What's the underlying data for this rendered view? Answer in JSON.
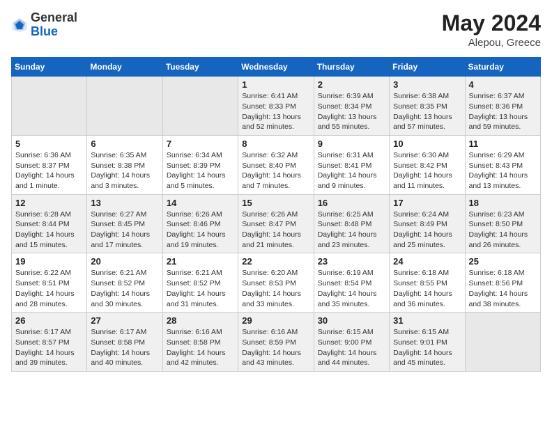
{
  "header": {
    "logo": {
      "line1": "General",
      "line2": "Blue"
    },
    "title": "May 2024",
    "location": "Alepou, Greece"
  },
  "weekdays": [
    "Sunday",
    "Monday",
    "Tuesday",
    "Wednesday",
    "Thursday",
    "Friday",
    "Saturday"
  ],
  "weeks": [
    [
      {
        "day": "",
        "sunrise": "",
        "sunset": "",
        "daylight": "",
        "empty": true
      },
      {
        "day": "",
        "sunrise": "",
        "sunset": "",
        "daylight": "",
        "empty": true
      },
      {
        "day": "",
        "sunrise": "",
        "sunset": "",
        "daylight": "",
        "empty": true
      },
      {
        "day": "1",
        "sunrise": "Sunrise: 6:41 AM",
        "sunset": "Sunset: 8:33 PM",
        "daylight": "Daylight: 13 hours and 52 minutes."
      },
      {
        "day": "2",
        "sunrise": "Sunrise: 6:39 AM",
        "sunset": "Sunset: 8:34 PM",
        "daylight": "Daylight: 13 hours and 55 minutes."
      },
      {
        "day": "3",
        "sunrise": "Sunrise: 6:38 AM",
        "sunset": "Sunset: 8:35 PM",
        "daylight": "Daylight: 13 hours and 57 minutes."
      },
      {
        "day": "4",
        "sunrise": "Sunrise: 6:37 AM",
        "sunset": "Sunset: 8:36 PM",
        "daylight": "Daylight: 13 hours and 59 minutes."
      }
    ],
    [
      {
        "day": "5",
        "sunrise": "Sunrise: 6:36 AM",
        "sunset": "Sunset: 8:37 PM",
        "daylight": "Daylight: 14 hours and 1 minute."
      },
      {
        "day": "6",
        "sunrise": "Sunrise: 6:35 AM",
        "sunset": "Sunset: 8:38 PM",
        "daylight": "Daylight: 14 hours and 3 minutes."
      },
      {
        "day": "7",
        "sunrise": "Sunrise: 6:34 AM",
        "sunset": "Sunset: 8:39 PM",
        "daylight": "Daylight: 14 hours and 5 minutes."
      },
      {
        "day": "8",
        "sunrise": "Sunrise: 6:32 AM",
        "sunset": "Sunset: 8:40 PM",
        "daylight": "Daylight: 14 hours and 7 minutes."
      },
      {
        "day": "9",
        "sunrise": "Sunrise: 6:31 AM",
        "sunset": "Sunset: 8:41 PM",
        "daylight": "Daylight: 14 hours and 9 minutes."
      },
      {
        "day": "10",
        "sunrise": "Sunrise: 6:30 AM",
        "sunset": "Sunset: 8:42 PM",
        "daylight": "Daylight: 14 hours and 11 minutes."
      },
      {
        "day": "11",
        "sunrise": "Sunrise: 6:29 AM",
        "sunset": "Sunset: 8:43 PM",
        "daylight": "Daylight: 14 hours and 13 minutes."
      }
    ],
    [
      {
        "day": "12",
        "sunrise": "Sunrise: 6:28 AM",
        "sunset": "Sunset: 8:44 PM",
        "daylight": "Daylight: 14 hours and 15 minutes."
      },
      {
        "day": "13",
        "sunrise": "Sunrise: 6:27 AM",
        "sunset": "Sunset: 8:45 PM",
        "daylight": "Daylight: 14 hours and 17 minutes."
      },
      {
        "day": "14",
        "sunrise": "Sunrise: 6:26 AM",
        "sunset": "Sunset: 8:46 PM",
        "daylight": "Daylight: 14 hours and 19 minutes."
      },
      {
        "day": "15",
        "sunrise": "Sunrise: 6:26 AM",
        "sunset": "Sunset: 8:47 PM",
        "daylight": "Daylight: 14 hours and 21 minutes."
      },
      {
        "day": "16",
        "sunrise": "Sunrise: 6:25 AM",
        "sunset": "Sunset: 8:48 PM",
        "daylight": "Daylight: 14 hours and 23 minutes."
      },
      {
        "day": "17",
        "sunrise": "Sunrise: 6:24 AM",
        "sunset": "Sunset: 8:49 PM",
        "daylight": "Daylight: 14 hours and 25 minutes."
      },
      {
        "day": "18",
        "sunrise": "Sunrise: 6:23 AM",
        "sunset": "Sunset: 8:50 PM",
        "daylight": "Daylight: 14 hours and 26 minutes."
      }
    ],
    [
      {
        "day": "19",
        "sunrise": "Sunrise: 6:22 AM",
        "sunset": "Sunset: 8:51 PM",
        "daylight": "Daylight: 14 hours and 28 minutes."
      },
      {
        "day": "20",
        "sunrise": "Sunrise: 6:21 AM",
        "sunset": "Sunset: 8:52 PM",
        "daylight": "Daylight: 14 hours and 30 minutes."
      },
      {
        "day": "21",
        "sunrise": "Sunrise: 6:21 AM",
        "sunset": "Sunset: 8:52 PM",
        "daylight": "Daylight: 14 hours and 31 minutes."
      },
      {
        "day": "22",
        "sunrise": "Sunrise: 6:20 AM",
        "sunset": "Sunset: 8:53 PM",
        "daylight": "Daylight: 14 hours and 33 minutes."
      },
      {
        "day": "23",
        "sunrise": "Sunrise: 6:19 AM",
        "sunset": "Sunset: 8:54 PM",
        "daylight": "Daylight: 14 hours and 35 minutes."
      },
      {
        "day": "24",
        "sunrise": "Sunrise: 6:18 AM",
        "sunset": "Sunset: 8:55 PM",
        "daylight": "Daylight: 14 hours and 36 minutes."
      },
      {
        "day": "25",
        "sunrise": "Sunrise: 6:18 AM",
        "sunset": "Sunset: 8:56 PM",
        "daylight": "Daylight: 14 hours and 38 minutes."
      }
    ],
    [
      {
        "day": "26",
        "sunrise": "Sunrise: 6:17 AM",
        "sunset": "Sunset: 8:57 PM",
        "daylight": "Daylight: 14 hours and 39 minutes."
      },
      {
        "day": "27",
        "sunrise": "Sunrise: 6:17 AM",
        "sunset": "Sunset: 8:58 PM",
        "daylight": "Daylight: 14 hours and 40 minutes."
      },
      {
        "day": "28",
        "sunrise": "Sunrise: 6:16 AM",
        "sunset": "Sunset: 8:58 PM",
        "daylight": "Daylight: 14 hours and 42 minutes."
      },
      {
        "day": "29",
        "sunrise": "Sunrise: 6:16 AM",
        "sunset": "Sunset: 8:59 PM",
        "daylight": "Daylight: 14 hours and 43 minutes."
      },
      {
        "day": "30",
        "sunrise": "Sunrise: 6:15 AM",
        "sunset": "Sunset: 9:00 PM",
        "daylight": "Daylight: 14 hours and 44 minutes."
      },
      {
        "day": "31",
        "sunrise": "Sunrise: 6:15 AM",
        "sunset": "Sunset: 9:01 PM",
        "daylight": "Daylight: 14 hours and 45 minutes."
      },
      {
        "day": "",
        "sunrise": "",
        "sunset": "",
        "daylight": "",
        "empty": true
      }
    ]
  ]
}
